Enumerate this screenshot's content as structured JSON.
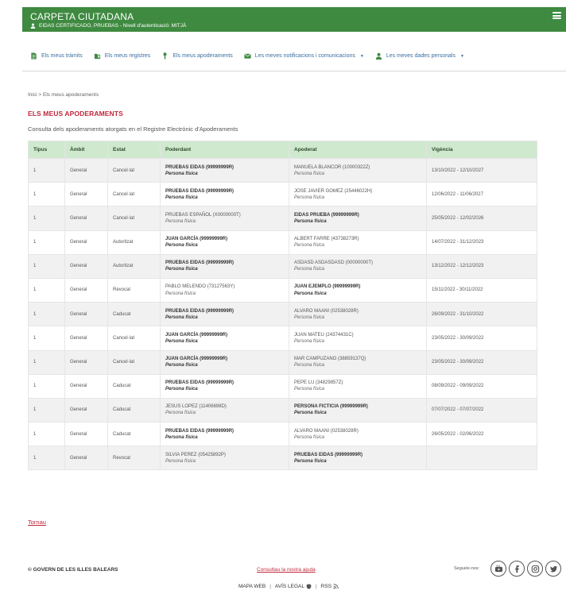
{
  "header": {
    "title": "CARPETA CIUTADANA",
    "user_text": "EIDAS CERTIFICADO, PRUEBAS - Nivell d'autenticació: MITJÀ"
  },
  "nav": [
    {
      "label": "Els meus tràmits",
      "icon": "document-icon"
    },
    {
      "label": "Els meus registres",
      "icon": "folder-icon"
    },
    {
      "label": "Els meus apoderaments",
      "icon": "person-pin-icon"
    },
    {
      "label": "Les meves notificacions i comunicacions",
      "icon": "envelope-icon",
      "caret": "▼"
    },
    {
      "label": "Les meves dades personals",
      "icon": "user-icon",
      "caret": "▼"
    }
  ],
  "breadcrumb": {
    "home": "Inici",
    "separator": ">",
    "current": "Els meus apoderaments"
  },
  "page_title": "ELS MEUS APODERAMENTS",
  "intro": "Consulta dels apoderaments atorgats en el Registre Electrònic d'Apoderaments",
  "table": {
    "headers": [
      "Tipus",
      "Àmbit",
      "Estat",
      "Poderdant",
      "Apoderat",
      "Vigència"
    ],
    "rows": [
      {
        "tipus": "1",
        "ambit": "General",
        "estat": "Cancel·lat",
        "poderdant": "PRUEBAS EIDAS (99999999R)",
        "poderdant_type": "Persona física",
        "poderdant_bold": true,
        "apoderat": "MANUELA BLANCOR (10000322Z)",
        "apoderat_type": "Persona física",
        "apoderat_bold": false,
        "vigencia": "13/10/2022 - 12/10/2027"
      },
      {
        "tipus": "1",
        "ambit": "General",
        "estat": "Cancel·lat",
        "poderdant": "PRUEBAS EIDAS (99999999R)",
        "poderdant_type": "Persona física",
        "poderdant_bold": true,
        "apoderat": "JOSE JAVIER GOMEZ (25446022H)",
        "apoderat_type": "Persona física",
        "apoderat_bold": false,
        "vigencia": "12/06/2022 - 11/06/2027"
      },
      {
        "tipus": "1",
        "ambit": "General",
        "estat": "Cancel·lat",
        "poderdant": "PRUEBAS ESPAÑOL (X0000000T)",
        "poderdant_type": "Persona física",
        "poderdant_bold": false,
        "apoderat": "EIDAS PRUEBA (99999999R)",
        "apoderat_type": "Persona física",
        "apoderat_bold": true,
        "vigencia": "25/05/2022 - 12/02/2026"
      },
      {
        "tipus": "1",
        "ambit": "General",
        "estat": "Autoritzat",
        "poderdant": "JUAN GARCÍA (99999999R)",
        "poderdant_type": "Persona física",
        "poderdant_bold": true,
        "apoderat": "ALBERT FARRE (43738273R)",
        "apoderat_type": "Persona física",
        "apoderat_bold": false,
        "vigencia": "14/07/2022 - 31/12/2023"
      },
      {
        "tipus": "1",
        "ambit": "General",
        "estat": "Autoritzat",
        "poderdant": "PRUEBAS EIDAS (99999999R)",
        "poderdant_type": "Persona física",
        "poderdant_bold": true,
        "apoderat": "ASDASD ASDASDASD (00000000T)",
        "apoderat_type": "Persona física",
        "apoderat_bold": false,
        "vigencia": "13/12/2022 - 12/12/2023"
      },
      {
        "tipus": "1",
        "ambit": "General",
        "estat": "Revocat",
        "poderdant": "PABLO MELENDO (73127563Y)",
        "poderdant_type": "Persona física",
        "poderdant_bold": false,
        "apoderat": "JUAN EJEMPLO (99999999R)",
        "apoderat_type": "Persona física",
        "apoderat_bold": true,
        "vigencia": "15/11/2022 - 30/11/2022"
      },
      {
        "tipus": "1",
        "ambit": "General",
        "estat": "Caducat",
        "poderdant": "PRUEBAS EIDAS (99999999R)",
        "poderdant_type": "Persona física",
        "poderdant_bold": true,
        "apoderat": "ALVARO MAANI (02538028R)",
        "apoderat_type": "Persona física",
        "apoderat_bold": false,
        "vigencia": "26/09/2022 - 31/10/2022"
      },
      {
        "tipus": "1",
        "ambit": "General",
        "estat": "Cancel·lat",
        "poderdant": "JUAN GARCÍA (99999999R)",
        "poderdant_type": "Persona física",
        "poderdant_bold": true,
        "apoderat": "JUAN MATEU (24374431C)",
        "apoderat_type": "Persona física",
        "apoderat_bold": false,
        "vigencia": "23/05/2022 - 30/09/2022"
      },
      {
        "tipus": "1",
        "ambit": "General",
        "estat": "Cancel·lat",
        "poderdant": "JUAN GARCÍA (99999999R)",
        "poderdant_type": "Persona física",
        "poderdant_bold": true,
        "apoderat": "MAR CAMPUZANO (38859137Q)",
        "apoderat_type": "Persona física",
        "apoderat_bold": false,
        "vigencia": "23/05/2022 - 30/09/2022"
      },
      {
        "tipus": "1",
        "ambit": "General",
        "estat": "Caducat",
        "poderdant": "PRUEBAS EIDAS (99999999R)",
        "poderdant_type": "Persona física",
        "poderdant_bold": true,
        "apoderat": "PEPE LU (34829857Z)",
        "apoderat_type": "Persona física",
        "apoderat_bold": false,
        "vigencia": "08/09/2022 - 09/09/2022"
      },
      {
        "tipus": "1",
        "ambit": "General",
        "estat": "Caducat",
        "poderdant": "JESUS LOPEZ (11406698D)",
        "poderdant_type": "Persona física",
        "poderdant_bold": false,
        "apoderat": "PERSONA FICTICIA (99999999R)",
        "apoderat_type": "Persona física",
        "apoderat_bold": true,
        "vigencia": "07/07/2022 - 07/07/2022"
      },
      {
        "tipus": "1",
        "ambit": "General",
        "estat": "Caducat",
        "poderdant": "PRUEBAS EIDAS (99999999R)",
        "poderdant_type": "Persona física",
        "poderdant_bold": true,
        "apoderat": "ALVARO MAANI (02538028R)",
        "apoderat_type": "Persona física",
        "apoderat_bold": false,
        "vigencia": "26/05/2022 - 02/06/2022"
      },
      {
        "tipus": "1",
        "ambit": "General",
        "estat": "Revocat",
        "poderdant": "SILVIA PEREZ (05425892P)",
        "poderdant_type": "Persona física",
        "poderdant_bold": false,
        "apoderat": "PRUEBAS EIDAS (99999999R)",
        "apoderat_type": "Persona física",
        "apoderat_bold": true,
        "vigencia": ""
      }
    ]
  },
  "back_link": "Tornau",
  "footer": {
    "copyright": "© GOVERN DE LES ILLES BALEARS",
    "help": "Consultau la nostra ajuda",
    "links": [
      {
        "label": "MAPA WEB",
        "icon": ""
      },
      {
        "label": "AVÍS LEGAL",
        "icon": "shield-icon"
      },
      {
        "label": "RSS",
        "icon": "rss-icon"
      }
    ],
    "separator": "|",
    "follow_label": "Segueix-nos:",
    "social": [
      "youtube-icon",
      "facebook-icon",
      "instagram-icon",
      "twitter-icon"
    ]
  },
  "colors": {
    "header_green": "#3f8a41",
    "table_header": "#cfe9cf",
    "accent_red": "#c0283c",
    "nav_blue": "#3a6fa0"
  }
}
